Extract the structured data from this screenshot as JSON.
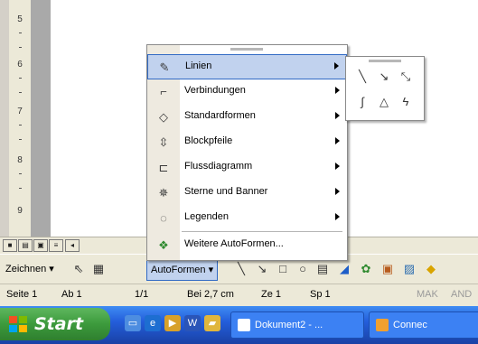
{
  "ruler": {
    "ticks": [
      "5",
      "6",
      "7",
      "8",
      "9"
    ]
  },
  "autoshapes_menu": {
    "items": [
      {
        "label": "Linien",
        "icon": "lines-icon",
        "has_submenu": true,
        "highlighted": true
      },
      {
        "label": "Verbindungen",
        "icon": "connectors-icon",
        "has_submenu": true
      },
      {
        "label": "Standardformen",
        "icon": "basic-shapes-icon",
        "has_submenu": true
      },
      {
        "label": "Blockpfeile",
        "icon": "block-arrows-icon",
        "has_submenu": true
      },
      {
        "label": "Flussdiagramm",
        "icon": "flowchart-icon",
        "has_submenu": true
      },
      {
        "label": "Sterne und Banner",
        "icon": "stars-banners-icon",
        "has_submenu": true
      },
      {
        "label": "Legenden",
        "icon": "callouts-icon",
        "has_submenu": true
      },
      {
        "label": "Weitere AutoFormen...",
        "icon": "more-autoshapes-icon",
        "has_submenu": false
      }
    ]
  },
  "lines_submenu": {
    "tools": [
      "line-icon",
      "arrow-icon",
      "double-arrow-icon",
      "curve-icon",
      "freeform-icon",
      "scribble-icon"
    ]
  },
  "drawing_toolbar": {
    "draw_label": "Zeichnen ▾",
    "autoshapes_label": "AutoFormen ▾",
    "icons": [
      "select-pointer-icon",
      "grid-icon",
      "line-icon",
      "arrow-icon",
      "rectangle-icon",
      "oval-icon",
      "textbox-icon",
      "wordart-icon",
      "diagram-icon",
      "clipart-icon",
      "picture-icon"
    ]
  },
  "statusbar": {
    "page": "Seite 1",
    "section": "Ab 1",
    "pages": "1/1",
    "position": "Bei 2,7 cm",
    "line": "Ze 1",
    "column": "Sp 1",
    "mak": "MAK",
    "and": "AND"
  },
  "taskbar": {
    "start_label": "Start",
    "tasks": [
      {
        "label": "Dokument2 - ...",
        "icon": "word-doc-icon"
      },
      {
        "label": "Connec",
        "icon": "connect-icon"
      }
    ]
  },
  "colors": {
    "menu_highlight": "#c1d2ee",
    "menu_highlight_border": "#316ac5",
    "taskbar_blue": "#245edb",
    "start_green": "#3c9a3c"
  }
}
